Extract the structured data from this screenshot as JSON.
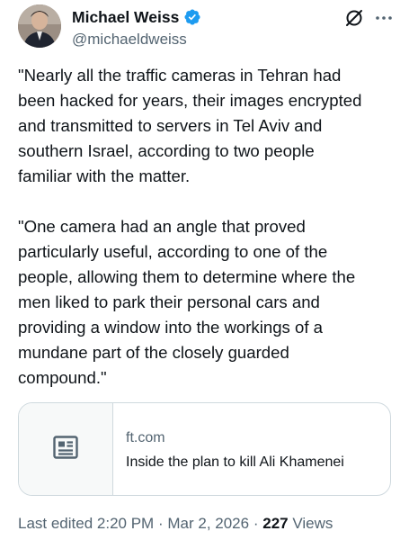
{
  "author": {
    "display_name": "Michael Weiss",
    "handle": "@michaeldweiss",
    "verified": true,
    "avatar": "avatar-photo"
  },
  "actions": {
    "grok_icon": "slashed-circle-icon",
    "more_icon": "more-horizontal-icon"
  },
  "tweet": {
    "paragraphs": [
      "\"Nearly all the traffic cameras in Tehran had\nbeen hacked for years, their images encrypted\nand transmitted to servers in Tel Aviv and\nsouthern Israel, according to two people\nfamiliar with the matter.",
      "\"One camera had an angle that proved\nparticularly useful, according to one of the\npeople, allowing them to determine where the\nmen liked to park their personal cars and\nproviding a window into the workings of a\nmundane part of the closely guarded\ncompound.\""
    ]
  },
  "link_card": {
    "domain": "ft.com",
    "title": "Inside the plan to kill Ali Khamenei",
    "icon": "article-icon"
  },
  "meta": {
    "last_edited": "Last edited 2:20 PM",
    "separator": "·",
    "date": "Mar 2, 2026",
    "views_count": "227",
    "views_label": "Views"
  },
  "colors": {
    "text_primary": "#0f1419",
    "text_secondary": "#536471",
    "verified_blue": "#1d9bf0",
    "border": "#cfd9de"
  }
}
